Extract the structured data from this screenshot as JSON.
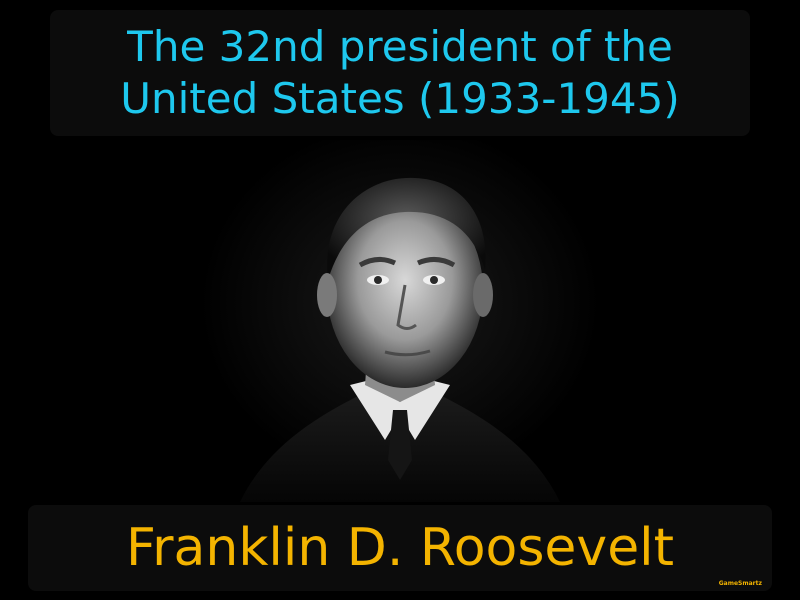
{
  "caption": {
    "line1": "The 32nd president of the",
    "line2": "United States (1933-1945)"
  },
  "term": "Franklin D. Roosevelt",
  "brand": "GameSmartz",
  "colors": {
    "background": "#000000",
    "caption_text": "#1ec8ee",
    "term_text": "#f4b400",
    "box": "#0c0c0c"
  },
  "image": {
    "subject": "black-and-white portrait photograph of a man in a suit"
  }
}
